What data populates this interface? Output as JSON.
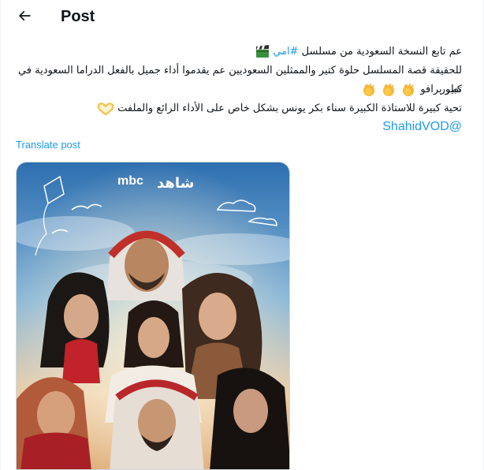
{
  "header": {
    "title": "Post",
    "back_icon": "arrow-left-icon"
  },
  "post": {
    "line1_text": "عم تابع النسخة السعودية من مسلسل ",
    "line1_hashtag": "#امي",
    "line1_emoji": "clapper-board-icon",
    "line2_text": "للحقيقة قصة المسلسل حلوة كتير والممثلين السعوديين عم يقدموا أداء جميل بالفعل الدراما السعودية في تطور",
    "line3_text": "كبير برافو",
    "line3_emoji": "clapping-hands-icon",
    "line4_text": "تحية كبيرة للاستاذة الكبيرة سناء بكر يونس بشكل خاص على الأداء الرائع والملفت",
    "line4_emoji": "heart-hands-icon",
    "mention": "@ShahidVOD",
    "translate_label": "Translate post"
  },
  "media": {
    "description_icon": "tv-series-poster-image",
    "logo_mbc": "mbc",
    "logo_shahid": "شاهد"
  },
  "colors": {
    "link": "#1d9bf0",
    "text": "#0f1419",
    "border": "#cfd9de"
  }
}
